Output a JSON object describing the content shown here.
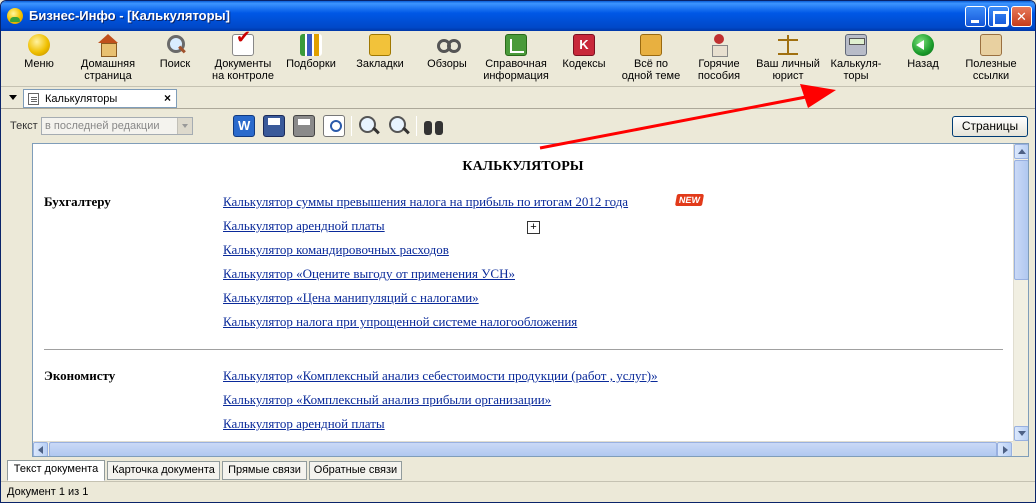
{
  "window": {
    "title": "Бизнес-Инфо - [Калькуляторы]"
  },
  "toolbar": {
    "items": [
      {
        "label1": "Меню",
        "label2": "",
        "icon": "menu-icon"
      },
      {
        "label1": "Домашняя",
        "label2": "страница",
        "icon": "home-icon"
      },
      {
        "label1": "Поиск",
        "label2": "",
        "icon": "search-icon"
      },
      {
        "label1": "Документы",
        "label2": "на контроле",
        "icon": "documents-control-icon"
      },
      {
        "label1": "Подборки",
        "label2": "",
        "icon": "collections-icon"
      },
      {
        "label1": "Закладки",
        "label2": "",
        "icon": "bookmarks-icon"
      },
      {
        "label1": "Обзоры",
        "label2": "",
        "icon": "reviews-icon"
      },
      {
        "label1": "Справочная",
        "label2": "информация",
        "icon": "reference-info-icon"
      },
      {
        "label1": "Кодексы",
        "label2": "",
        "icon": "codes-icon"
      },
      {
        "label1": "Всё по",
        "label2": "одной теме",
        "icon": "one-topic-icon"
      },
      {
        "label1": "Горячие",
        "label2": "пособия",
        "icon": "hot-guides-icon"
      },
      {
        "label1": "Ваш личный",
        "label2": "юрист",
        "icon": "lawyer-scales-icon"
      },
      {
        "label1": "Калькуля-",
        "label2": "торы",
        "icon": "calculator-icon"
      },
      {
        "label1": "Назад",
        "label2": "",
        "icon": "back-arrow-icon"
      },
      {
        "label1": "Полезные",
        "label2": "ссылки",
        "icon": "useful-links-icon"
      }
    ],
    "codex_glyph": "K"
  },
  "doc_tab": {
    "label": "Калькуляторы",
    "close": "×"
  },
  "toolbar2": {
    "text_label": "Текст",
    "edition_value": "в последней редакции",
    "pages_button": "Страницы"
  },
  "content": {
    "title": "КАЛЬКУЛЯТОРЫ",
    "new_badge": "NEW",
    "plus": "+",
    "sections": [
      {
        "label": "Бухгалтеру",
        "links": [
          "Калькулятор суммы превышения налога на прибыль по итогам 2012 года",
          "Калькулятор арендной платы",
          "Калькулятор командировочных расходов",
          "Калькулятор «Оцените выгоду от применения УСН»",
          "Калькулятор «Цена манипуляций с налогами»",
          "Калькулятор налога при упрощенной системе налогообложения"
        ]
      },
      {
        "label": "Экономисту",
        "links": [
          "Калькулятор «Комплексный анализ себестоимости продукции (работ , услуг)»",
          "Калькулятор «Комплексный анализ прибыли организации»",
          "Калькулятор арендной платы"
        ]
      }
    ]
  },
  "bottom_tabs": [
    "Текст документа",
    "Карточка документа",
    "Прямые связи",
    "Обратные связи"
  ],
  "status": {
    "text": "Документ 1 из 1"
  },
  "colors": {
    "link": "#0a2a9a",
    "title_bar": "#0058e6",
    "annotation_arrow": "#ff0000",
    "new_badge": "#e23a1a"
  }
}
